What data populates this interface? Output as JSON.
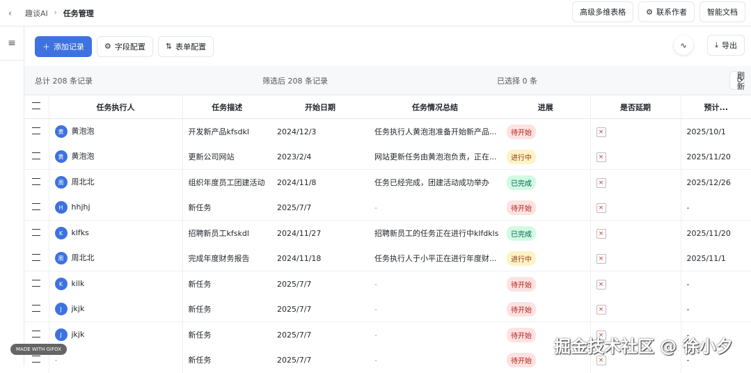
{
  "header": {
    "breadcrumb": [
      "趣谈AI",
      "任务管理"
    ],
    "buttons": [
      "高级多维表格",
      "联系作者",
      "智能文档"
    ]
  },
  "toolbar": {
    "add": "添加记录",
    "fields": "字段配置",
    "form": "表单配置",
    "export": "导出"
  },
  "stats": {
    "total": "总计 208 条记录",
    "filtered": "筛选后 208 条记录",
    "selected": "已选择 0 条",
    "refresh": "刷新"
  },
  "columns": [
    "任务执行人",
    "任务描述",
    "开始日期",
    "任务情况总结",
    "进展",
    "是否延期",
    "预计..."
  ],
  "status_colors": {
    "待开始": {
      "bg": "#fde2e2",
      "fg": "#b42318"
    },
    "进行中": {
      "bg": "#fef3c7",
      "fg": "#92400e"
    },
    "已完成": {
      "bg": "#d1fae5",
      "fg": "#065f46"
    }
  },
  "rows": [
    {
      "avatar": "黄",
      "name": "黄泡泡",
      "desc": "开发新产品kfsdkl",
      "start": "2024/12/3",
      "summary": "任务执行人黄泡泡准备开始新产品...",
      "status": "待开始",
      "delay": "×",
      "due": "2025/10/1"
    },
    {
      "avatar": "黄",
      "name": "黄泡泡",
      "desc": "更新公司网站",
      "start": "2023/2/4",
      "summary": "网站更新任务由黄泡泡负责，正在...",
      "status": "进行中",
      "delay": "×",
      "due": "2025/11/20"
    },
    {
      "avatar": "周",
      "name": "周北北",
      "desc": "组织年度员工团建活动",
      "start": "2024/11/8",
      "summary": "任务已经完成，团建活动成功举办",
      "status": "已完成",
      "delay": "×",
      "due": "2025/12/26"
    },
    {
      "avatar": "H",
      "name": "hhjhj",
      "desc": "新任务",
      "start": "2025/7/7",
      "summary": "-",
      "status": "待开始",
      "delay": "×",
      "due": "-"
    },
    {
      "avatar": "K",
      "name": "klfks",
      "desc": "招聘新员工kfskdl",
      "start": "2024/11/27",
      "summary": "招聘新员工的任务正在进行中klfdkls",
      "status": "已完成",
      "delay": "×",
      "due": "2025/11/20"
    },
    {
      "avatar": "周",
      "name": "周北北",
      "desc": "完成年度财务报告",
      "start": "2024/11/18",
      "summary": "任务执行人于小平正在进行年度财...",
      "status": "进行中",
      "delay": "×",
      "due": "2025/11/1"
    },
    {
      "avatar": "K",
      "name": "kilk",
      "desc": "新任务",
      "start": "2025/7/7",
      "summary": "-",
      "status": "待开始",
      "delay": "×",
      "due": "-"
    },
    {
      "avatar": "J",
      "name": "jkjk",
      "desc": "新任务",
      "start": "2025/7/7",
      "summary": "-",
      "status": "待开始",
      "delay": "×",
      "due": "-"
    },
    {
      "avatar": "J",
      "name": "jkjk",
      "desc": "新任务",
      "start": "2025/7/7",
      "summary": "-",
      "status": "待开始",
      "delay": "×",
      "due": "-"
    },
    {
      "avatar": "",
      "name": "-",
      "desc": "新任务",
      "start": "2025/7/7",
      "summary": "-",
      "status": "待开始",
      "delay": "×",
      "due": "-"
    }
  ],
  "overlays": {
    "gifox": "MADE WITH GIFOX",
    "watermark": "掘金技术社区 @ 徐小夕"
  }
}
